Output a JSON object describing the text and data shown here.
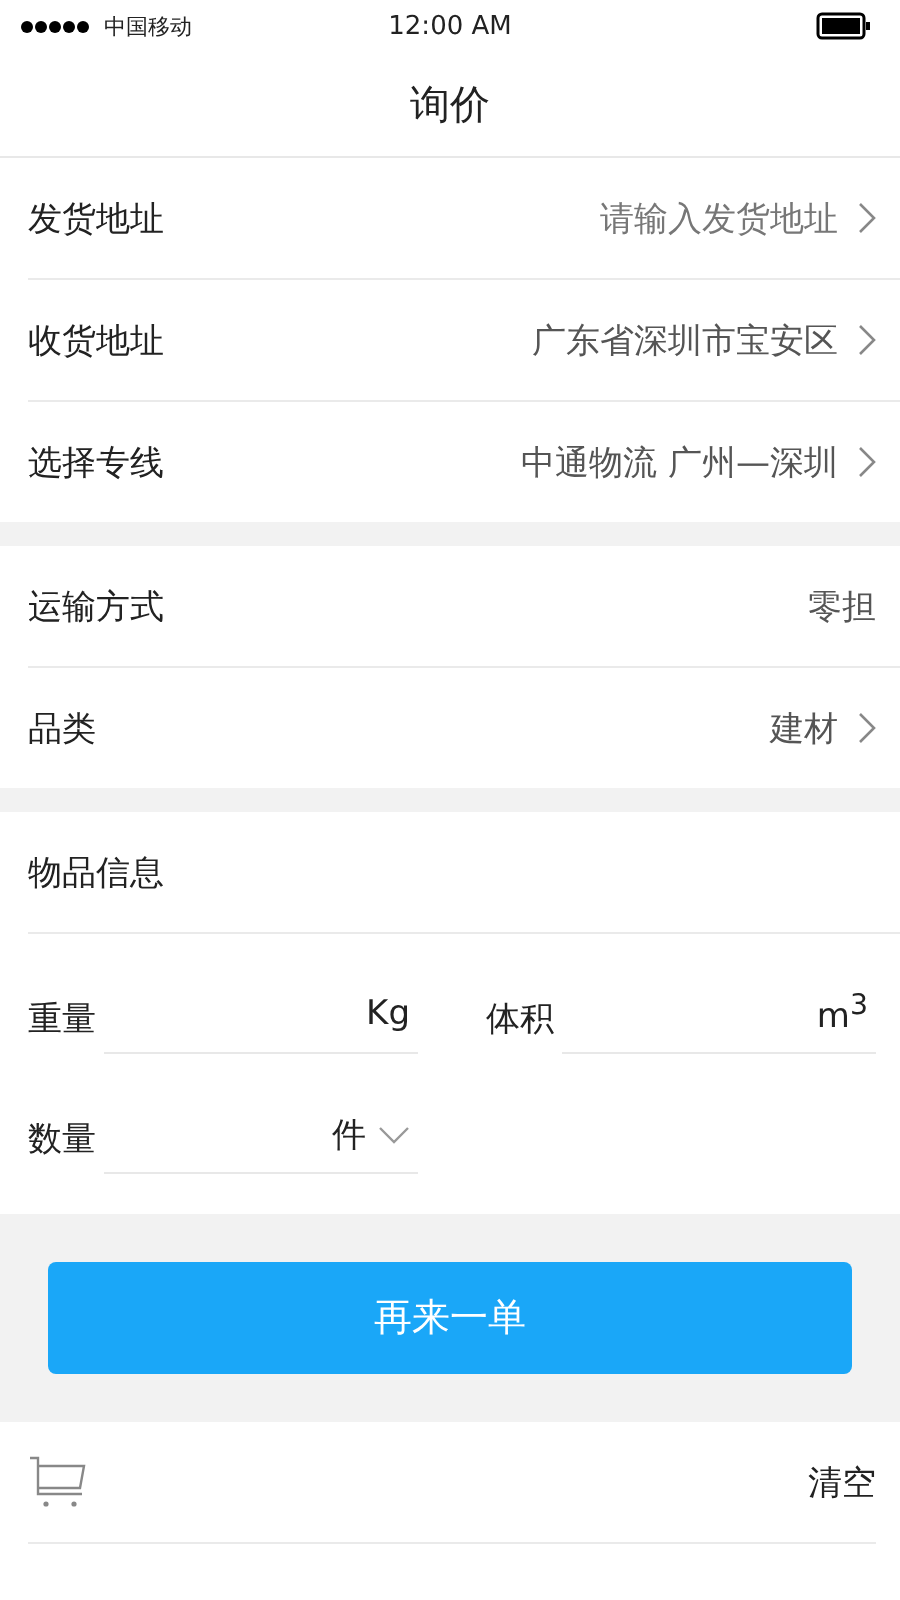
{
  "status_bar": {
    "carrier": "中国移动",
    "time": "12:00 AM"
  },
  "title": "询价",
  "groups": [
    {
      "rows": [
        {
          "label": "发货地址",
          "value": "请输入发货地址",
          "kind": "link",
          "placeholder": true
        },
        {
          "label": "收货地址",
          "value": "广东省深圳市宝安区",
          "kind": "link",
          "placeholder": false
        },
        {
          "label": "选择专线",
          "value": "中通物流 广州—深圳",
          "kind": "link",
          "placeholder": false
        }
      ]
    },
    {
      "rows": [
        {
          "label": "运输方式",
          "value": "零担",
          "kind": "static",
          "placeholder": false
        },
        {
          "label": "品类",
          "value": "建材",
          "kind": "link",
          "placeholder": false
        }
      ]
    }
  ],
  "goods": {
    "title": "物品信息",
    "fields": [
      {
        "label": "重量",
        "unit": "Kg",
        "kind": "input"
      },
      {
        "label": "体积",
        "unit": "m$^{3}$",
        "kind": "input"
      },
      {
        "label": "数量",
        "unit": "件",
        "kind": "select"
      }
    ]
  },
  "submit_button": "再来一单",
  "cart": {
    "clear": "清空"
  }
}
